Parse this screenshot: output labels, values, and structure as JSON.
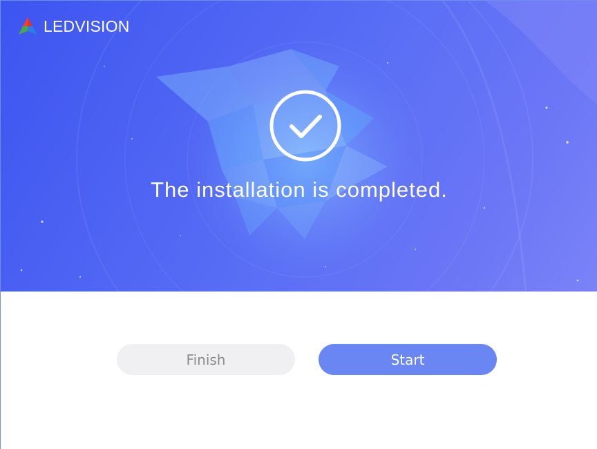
{
  "brand": {
    "name": "LEDVISION",
    "logo_icon": "ledvision-tri-color-logo"
  },
  "hero": {
    "status_icon": "check-circle-icon",
    "message": "The installation is completed."
  },
  "actions": {
    "finish_label": "Finish",
    "start_label": "Start"
  },
  "colors": {
    "hero_gradient_start": "#3d55f0",
    "hero_gradient_end": "#7a83f7",
    "start_button": "#6a86f2",
    "finish_button": "#f0f0f2",
    "finish_text": "#8b8b8e"
  }
}
